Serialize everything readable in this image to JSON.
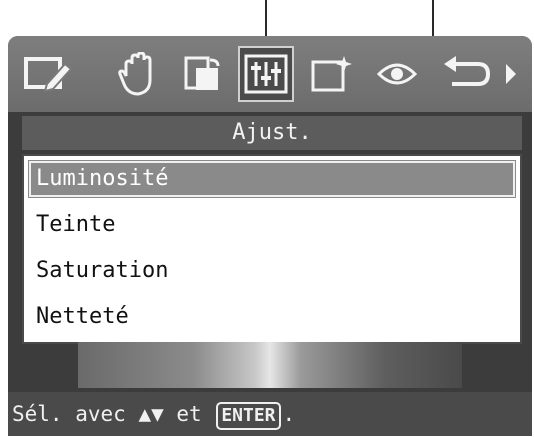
{
  "panel": {
    "title": "Ajust."
  },
  "menu": {
    "items": [
      {
        "label": "Luminosité",
        "selected": true
      },
      {
        "label": "Teinte",
        "selected": false
      },
      {
        "label": "Saturation",
        "selected": false
      },
      {
        "label": "Netteté",
        "selected": false
      }
    ]
  },
  "help": {
    "prefix": "Sél. avec ",
    "arrows": "▲▼",
    "middle": " et ",
    "enter": "ENTER",
    "suffix": "."
  },
  "toolbar": {
    "icons": [
      "edit-icon",
      "hand-icon",
      "rotate-icon",
      "adjust-icon",
      "effect-icon",
      "view-icon",
      "undo-icon",
      "next-arrow-icon"
    ],
    "selected": "adjust-icon"
  },
  "colors": {
    "screen": "#3c3c3c",
    "toolbar": "#7e7e7e",
    "header": "#5c5c5c",
    "highlight": "#8a8a8a"
  }
}
